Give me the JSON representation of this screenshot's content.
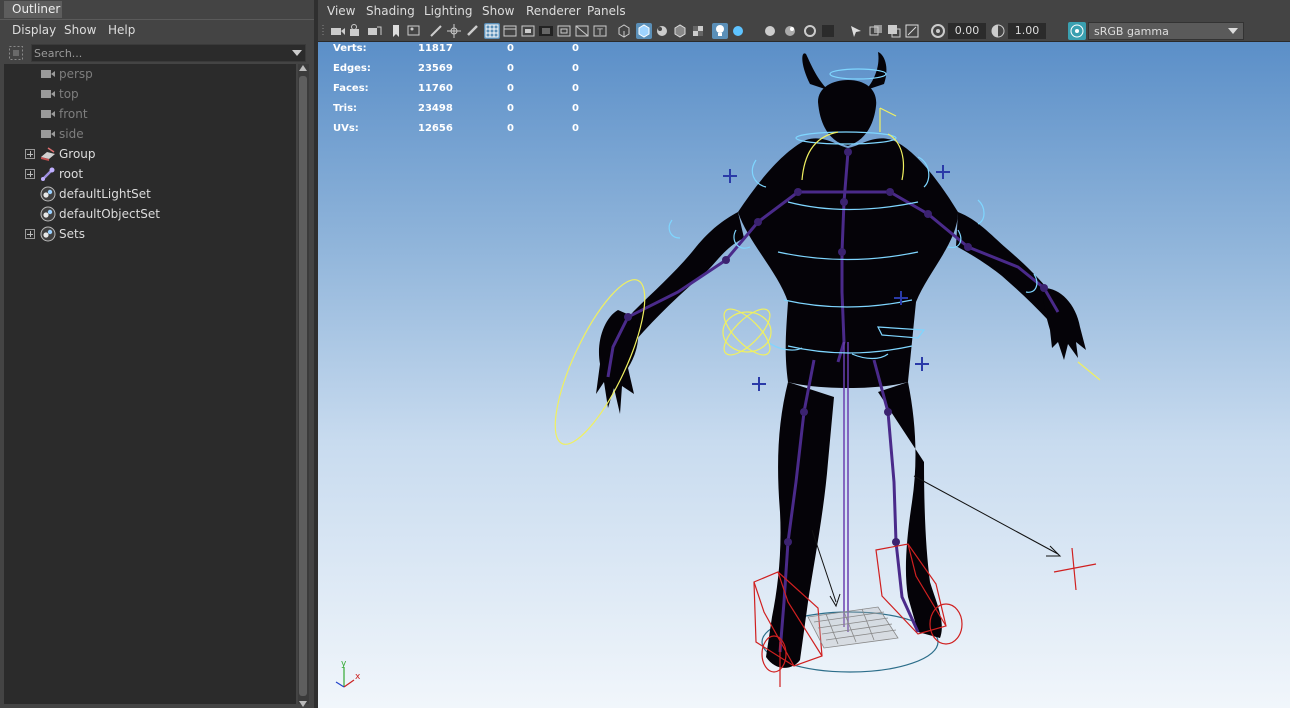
{
  "outliner": {
    "tab_title": "Outliner",
    "menu": [
      "Display",
      "Show",
      "Help"
    ],
    "search_placeholder": "Search...",
    "items": [
      {
        "label": "persp",
        "icon": "camera-icon",
        "dim": true,
        "expandable": false
      },
      {
        "label": "top",
        "icon": "camera-icon",
        "dim": true,
        "expandable": false
      },
      {
        "label": "front",
        "icon": "camera-icon",
        "dim": true,
        "expandable": false
      },
      {
        "label": "side",
        "icon": "camera-icon",
        "dim": true,
        "expandable": false
      },
      {
        "label": "Group",
        "icon": "group-transform-icon",
        "dim": false,
        "expandable": true
      },
      {
        "label": "root",
        "icon": "joint-icon",
        "dim": false,
        "expandable": true
      },
      {
        "label": "defaultLightSet",
        "icon": "set-icon",
        "dim": false,
        "expandable": false
      },
      {
        "label": "defaultObjectSet",
        "icon": "set-icon",
        "dim": false,
        "expandable": false
      },
      {
        "label": "Sets",
        "icon": "set-icon",
        "dim": false,
        "expandable": true
      }
    ]
  },
  "viewport": {
    "menu": [
      "View",
      "Shading",
      "Lighting",
      "Show",
      "Renderer",
      "Panels"
    ],
    "exposure": "0.00",
    "gamma": "1.00",
    "color_space": "sRGB gamma",
    "hud": [
      {
        "label": "Verts:",
        "values": [
          "11817",
          "0",
          "0"
        ]
      },
      {
        "label": "Edges:",
        "values": [
          "23569",
          "0",
          "0"
        ]
      },
      {
        "label": "Faces:",
        "values": [
          "11760",
          "0",
          "0"
        ]
      },
      {
        "label": "Tris:",
        "values": [
          "23498",
          "0",
          "0"
        ]
      },
      {
        "label": "UVs:",
        "values": [
          "12656",
          "0",
          "0"
        ]
      }
    ],
    "axis_labels": {
      "y": "y",
      "x": "x"
    }
  },
  "colors": {
    "viewport_top": "#5b8fc8",
    "viewport_bottom": "#f1f6fb",
    "selection_blue": "#5a8fb8",
    "ik_control_yellow": "#f0f060",
    "fk_control_cyan": "#7fd6ff",
    "foot_control_red": "#d02020",
    "joint_purple": "#4a2a8a"
  }
}
